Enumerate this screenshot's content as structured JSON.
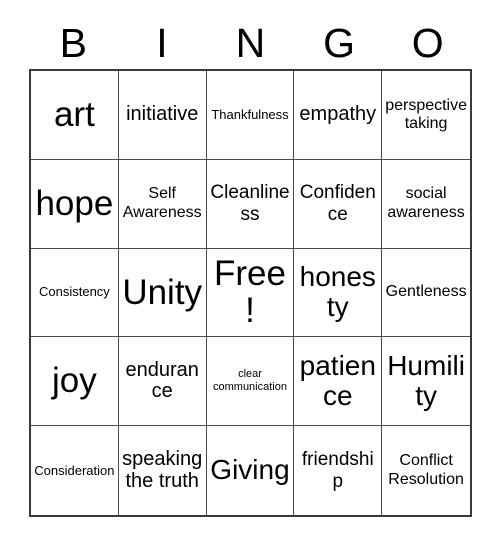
{
  "card": {
    "title": "BINGO",
    "header_letters": [
      "B",
      "I",
      "N",
      "G",
      "O"
    ],
    "free_space_label": "Free!",
    "grid_size": "5x5",
    "border_color": "#3a3a3a",
    "text_color": "#000000",
    "background_color": "#ffffff",
    "rows": [
      [
        {
          "label": "art",
          "size": "xl"
        },
        {
          "label": "initiative",
          "size": "md"
        },
        {
          "label": "Thankfulness",
          "size": "xs"
        },
        {
          "label": "empathy",
          "size": "md"
        },
        {
          "label": "perspective taking",
          "size": "sm"
        }
      ],
      [
        {
          "label": "hope",
          "size": "xl"
        },
        {
          "label": "Self Awareness",
          "size": "sm"
        },
        {
          "label": "Cleanliness",
          "size": "mdw"
        },
        {
          "label": "Confidence",
          "size": "mdw"
        },
        {
          "label": "social awareness",
          "size": "sm"
        }
      ],
      [
        {
          "label": "Consistency",
          "size": "xs"
        },
        {
          "label": "Unity",
          "size": "xl"
        },
        {
          "label": "Free!",
          "size": "xl"
        },
        {
          "label": "honesty",
          "size": "lg"
        },
        {
          "label": "Gentleness",
          "size": "sm"
        }
      ],
      [
        {
          "label": "joy",
          "size": "xl"
        },
        {
          "label": "endurance",
          "size": "md"
        },
        {
          "label": "clear communication",
          "size": "xxs"
        },
        {
          "label": "patience",
          "size": "lg"
        },
        {
          "label": "Humility",
          "size": "lg"
        }
      ],
      [
        {
          "label": "Consideration",
          "size": "xs"
        },
        {
          "label": "speaking the truth",
          "size": "md"
        },
        {
          "label": "Giving",
          "size": "lg"
        },
        {
          "label": "friendship",
          "size": "mdw"
        },
        {
          "label": "Conflict Resolution",
          "size": "sm"
        }
      ]
    ]
  }
}
